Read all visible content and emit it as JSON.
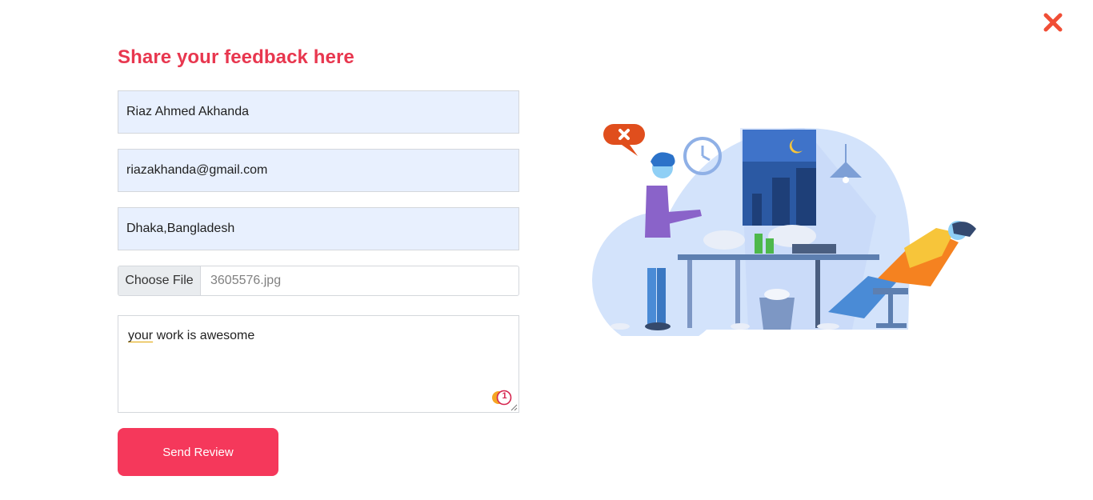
{
  "form": {
    "title": "Share your feedback here",
    "name_value": "Riaz Ahmed Akhanda",
    "email_value": "riazakhanda@gmail.com",
    "address_value": "Dhaka,Bangladesh",
    "file_button_label": "Choose File",
    "file_name": "3605576.jpg",
    "message_misspelled": "your",
    "message_rest": " work is awesome",
    "grammarly_count": "1",
    "submit_label": "Send Review"
  },
  "icons": {
    "close": "close-icon",
    "grammarly": "grammarly-icon",
    "resize": "resize-grip-icon"
  },
  "colors": {
    "title": "#e8374f",
    "button": "#f5385b",
    "close": "#f04e36",
    "field_bg": "#e8f0fe"
  }
}
